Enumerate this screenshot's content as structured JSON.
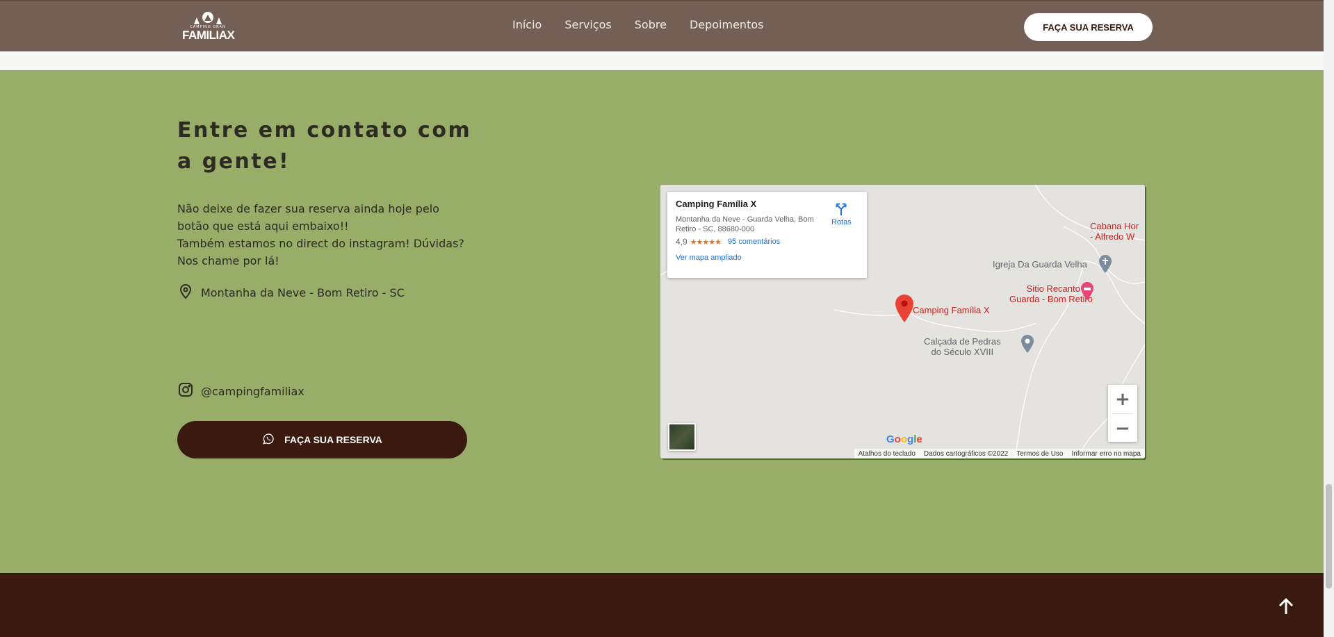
{
  "header": {
    "logo_small": "CAMPING GRAN",
    "logo_big": "FAMILIAX",
    "nav": [
      "Início",
      "Serviços",
      "Sobre",
      "Depoimentos"
    ],
    "cta": "FAÇA SUA RESERVA"
  },
  "contact": {
    "title": "Entre em contato com a gente!",
    "desc1": "Não deixe de fazer sua reserva ainda hoje pelo botão que está aqui embaixo!!",
    "desc2": "Também estamos no direct do instagram! Dúvidas? Nos chame por lá!",
    "location": "Montanha da Neve - Bom Retiro - SC",
    "instagram": "@campingfamiliax",
    "cta": "FAÇA SUA RESERVA",
    "location_icon": "map-pin-icon",
    "instagram_icon": "instagram-icon",
    "whatsapp_icon": "whatsapp-icon"
  },
  "map": {
    "card": {
      "name": "Camping Família X",
      "address": "Montanha da Neve - Guarda Velha, Bom Retiro - SC, 88680-000",
      "rating": "4,9",
      "stars": "★★★★★",
      "reviews": "95 comentários",
      "larger": "Ver mapa ampliado",
      "directions": "Rotas"
    },
    "labels": {
      "cabana": "Cabana Hor\n- Alfredo W",
      "igreja": "Igreja Da Guarda Velha",
      "sitio": "Sitio Recanto da\nGuarda - Bom Retiro",
      "camping": "Camping Família X",
      "calcada": "Calçada de Pedras\ndo Século XVIII"
    },
    "zoom_in": "+",
    "zoom_out": "−",
    "google": "Google",
    "footer": [
      "Atalhos do teclado",
      "Dados cartográficos ©2022",
      "Termos de Uso",
      "Informar erro no mapa"
    ]
  },
  "colors": {
    "header": "#735f55",
    "section": "#98ad68",
    "dark": "#3a1a0f"
  }
}
